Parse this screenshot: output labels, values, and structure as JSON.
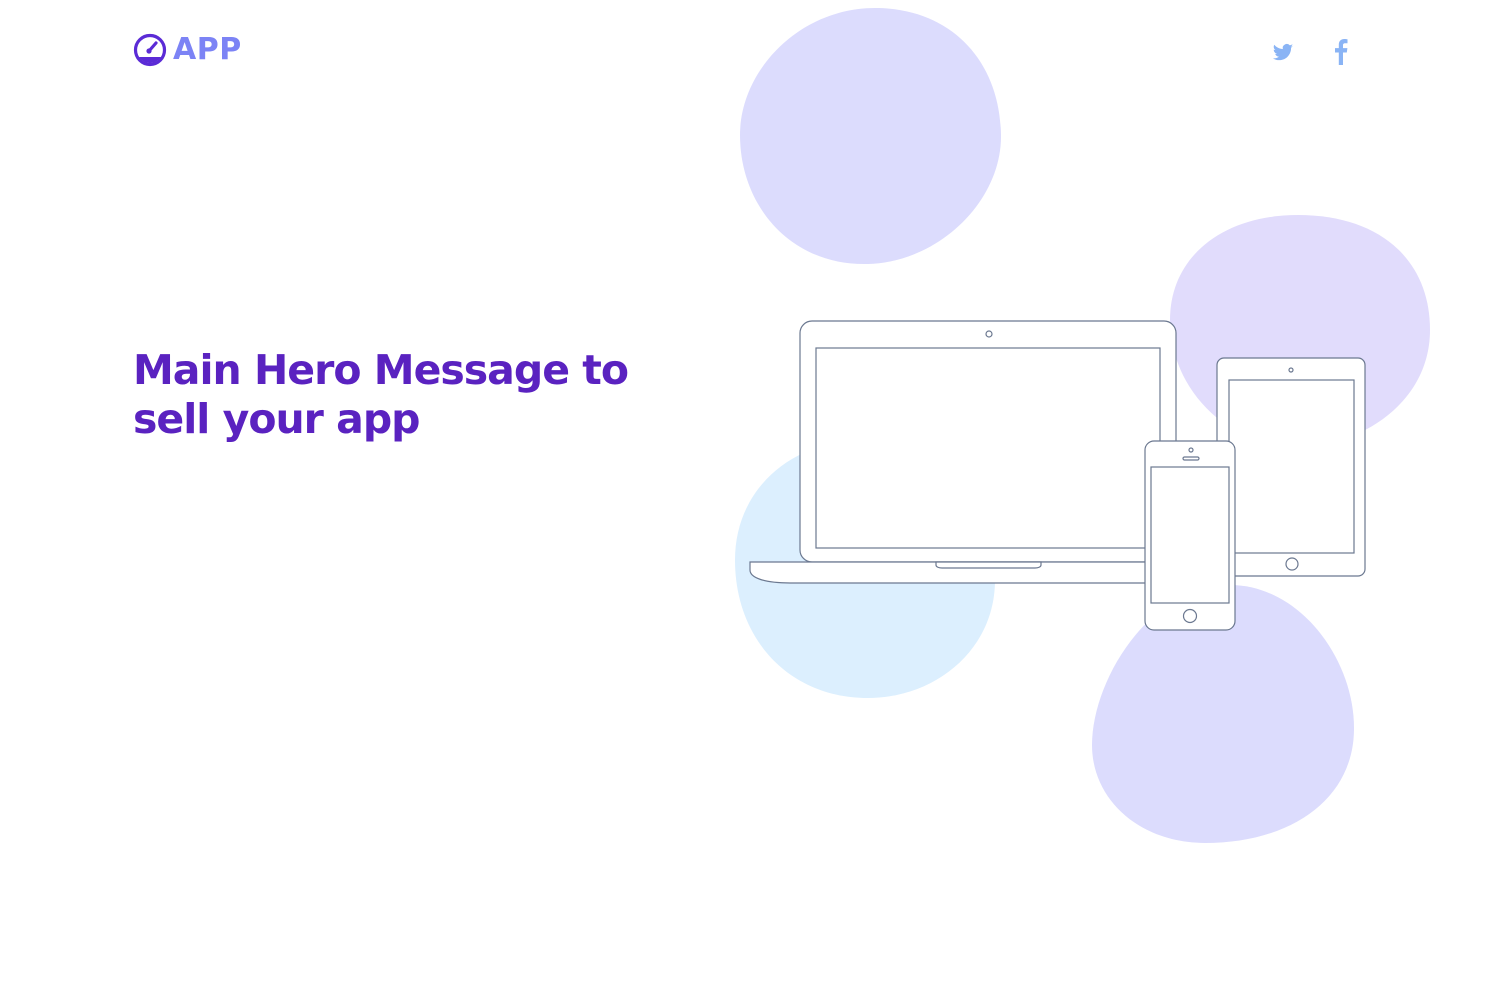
{
  "brand": {
    "logo_text": "APP",
    "logo_icon": "speedometer-icon"
  },
  "header": {
    "social_links": [
      {
        "icon": "twitter-icon"
      },
      {
        "icon": "facebook-icon"
      }
    ]
  },
  "hero": {
    "title": "Main Hero Message to sell your app"
  },
  "illustration": {
    "devices": [
      "laptop",
      "tablet",
      "phone"
    ]
  },
  "colors": {
    "brand_primary": "#5b2bd6",
    "brand_light": "#7c83f5",
    "headline": "#5a22c0",
    "social": "#8ab4f5",
    "blob_lavender": "#dcdcfd",
    "blob_purple": "#e1dcfc",
    "blob_blue": "#dceffe",
    "device_stroke": "#6b7890"
  }
}
